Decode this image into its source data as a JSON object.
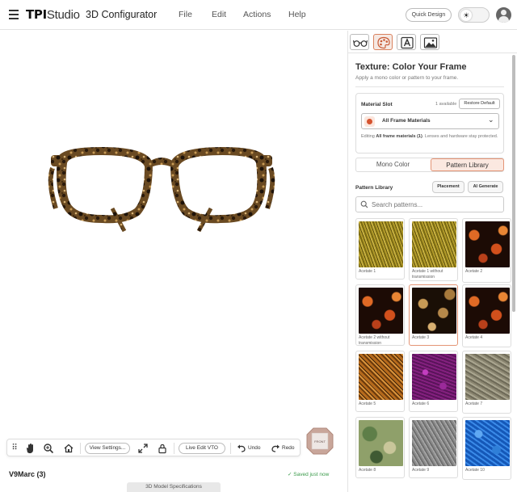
{
  "header": {
    "logo_bold": "TPI",
    "logo_light": "Studio",
    "app_title": "3D Configurator",
    "menu": [
      "File",
      "Edit",
      "Actions",
      "Help"
    ],
    "quick_design": "Quick Design",
    "theme_icon": "sun-icon"
  },
  "viewport": {
    "model_name": "V9Marc (3)",
    "saved_status": "✓ Saved just now",
    "specs_tab": "3D Model Specifications",
    "orientation_cube": "FRONT",
    "toolbar": {
      "view_settings": "View Settings...",
      "live_edit": "Live Edit VTO",
      "undo": "Undo",
      "redo": "Redo"
    }
  },
  "panel": {
    "tabs": [
      "glasses-icon",
      "palette-icon",
      "text-icon",
      "image-icon"
    ],
    "active_tab": 1,
    "title": "Texture: Color Your Frame",
    "subtitle": "Apply a mono color or pattern to your frame.",
    "material_slot": {
      "label": "Material Slot",
      "available": "1 available",
      "restore": "Restore Default",
      "selected": "All Frame Materials",
      "note_prefix": "Editing ",
      "note_bold": "All frame materials (1)",
      "note_suffix": ". Lenses and hardware stay protected."
    },
    "mode_tabs": {
      "mono": "Mono Color",
      "pattern": "Pattern Library",
      "active": "pattern"
    },
    "pattern_library": {
      "label": "Pattern Library",
      "placement": "Placement",
      "ai_generate": "AI Generate",
      "search_placeholder": "Search patterns...",
      "patterns": [
        {
          "name": "Acetate 1",
          "kind": "olive"
        },
        {
          "name": "Acetate 1 without transmission",
          "kind": "olive"
        },
        {
          "name": "Acetate 2",
          "kind": "tortoise-red"
        },
        {
          "name": "Acetate 2 without transmission",
          "kind": "tortoise-red"
        },
        {
          "name": "Acetate 3",
          "kind": "tortoise-gold"
        },
        {
          "name": "Acetate 4",
          "kind": "tortoise-red"
        },
        {
          "name": "Acetate 5",
          "kind": "amber-stripe"
        },
        {
          "name": "Acetate 6",
          "kind": "purple-speckle"
        },
        {
          "name": "Acetate 7",
          "kind": "grey-waves"
        },
        {
          "name": "Acetate 8",
          "kind": "camo"
        },
        {
          "name": "Acetate 9",
          "kind": "grey-wool"
        },
        {
          "name": "Acetate 10",
          "kind": "blue-crystal"
        }
      ],
      "selected_index": 4
    }
  }
}
